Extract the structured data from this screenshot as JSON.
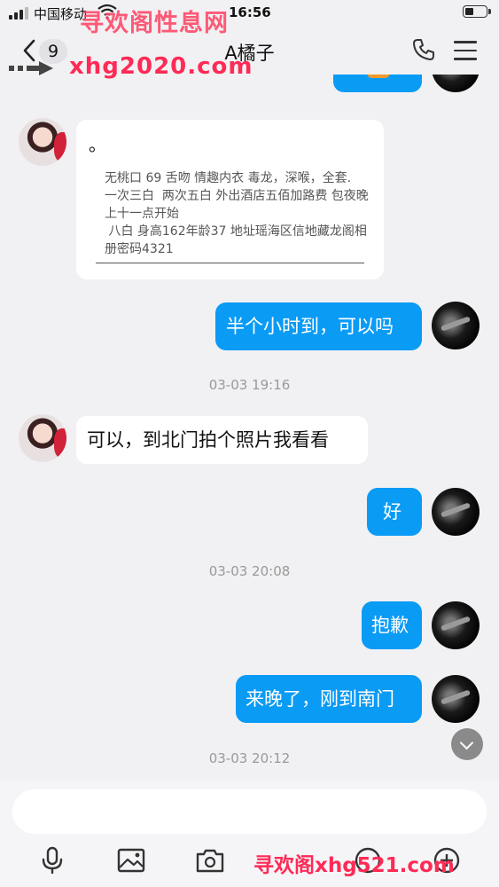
{
  "status_bar": {
    "carrier": "中国移动",
    "time": "16:56",
    "battery_percent": 40
  },
  "header": {
    "back_count": "9",
    "title": "A橘子"
  },
  "watermarks": {
    "top_line1": "寻欢阁性息网",
    "top_line2": "xhg2020.com",
    "bottom": "寻欢阁xhg521.com"
  },
  "messages": [
    {
      "from": "me",
      "type": "partial",
      "text": ""
    },
    {
      "from": "her",
      "type": "card",
      "title": "。",
      "body": "无桃口 69 舌吻 情趣内衣 毒龙，深喉，全套.\n一次三白  两次五白 外出酒店五佰加路费 包夜晚上十一点开始\n 八白 身高162年龄37 地址瑶海区信地藏龙阁相册密码4321"
    },
    {
      "from": "me",
      "type": "text",
      "text": "半个小时到，可以吗"
    },
    {
      "type": "timestamp",
      "text": "03-03 19:16"
    },
    {
      "from": "her",
      "type": "text",
      "text": "可以，到北门拍个照片我看看"
    },
    {
      "from": "me",
      "type": "text",
      "text": "好"
    },
    {
      "type": "timestamp",
      "text": "03-03 20:08"
    },
    {
      "from": "me",
      "type": "text",
      "text": "抱歉"
    },
    {
      "from": "me",
      "type": "text",
      "text": "来晚了，刚到南门"
    },
    {
      "type": "timestamp",
      "text": "03-03 20:12"
    }
  ],
  "input": {
    "placeholder": "",
    "value": ""
  },
  "toolbar": [
    "microphone-icon",
    "image-icon",
    "camera-icon",
    "emoji-icon",
    "plus-icon"
  ],
  "colors": {
    "outgoing_bubble": "#0a9bf5",
    "incoming_bubble": "#ffffff",
    "background": "#f1f1f3",
    "watermark": "#ff2a56"
  }
}
